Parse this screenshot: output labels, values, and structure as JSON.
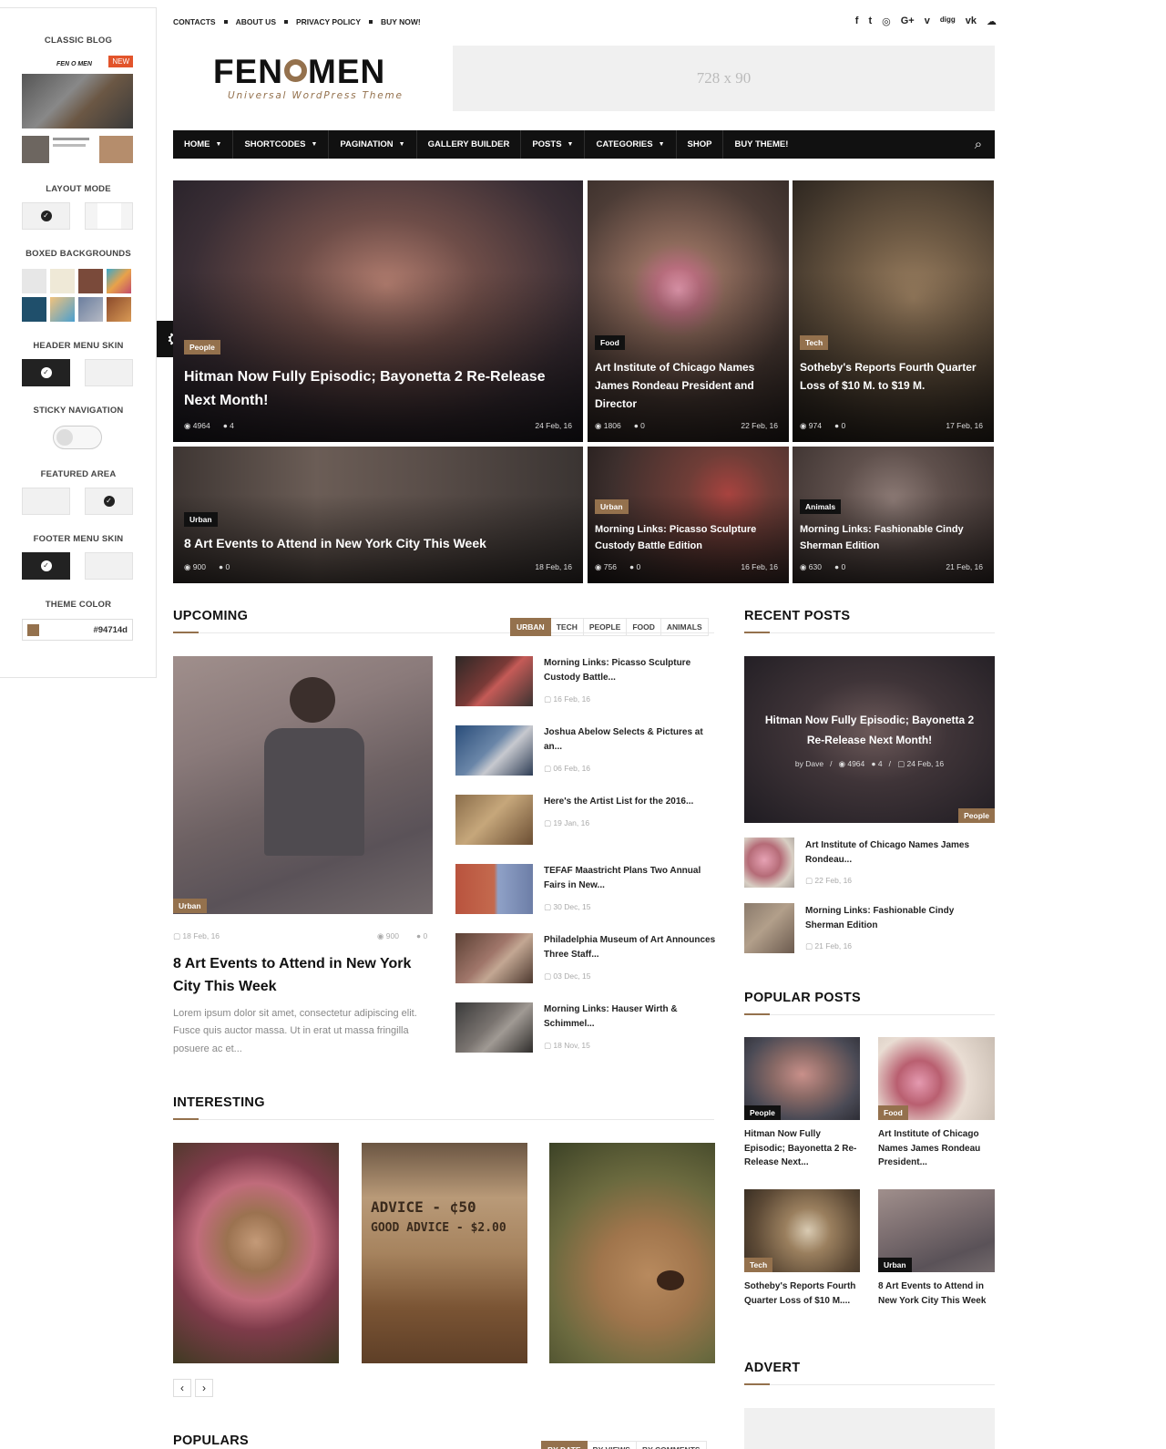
{
  "customizer": {
    "classic_blog": "CLASSIC BLOG",
    "preview_logo": "FEN O MEN",
    "new_badge": "NEW",
    "layout_mode": "LAYOUT MODE",
    "boxed_backgrounds": "BOXED BACKGROUNDS",
    "header_menu_skin": "HEADER MENU SKIN",
    "sticky_navigation": "STICKY NAVIGATION",
    "sticky_enabled": false,
    "featured_area": "FEATURED AREA",
    "footer_menu_skin": "FOOTER MENU SKIN",
    "theme_color_label": "THEME COLOR",
    "theme_color": "#94714d",
    "check_glyph": "✓",
    "gear_glyph": "⚙"
  },
  "topbar": {
    "links": [
      "CONTACTS",
      "ABOUT US",
      "PRIVACY POLICY",
      "BUY NOW!"
    ],
    "socials": [
      "f",
      "t",
      "◎",
      "G+",
      "v",
      "digg",
      "vk",
      "☁"
    ]
  },
  "header": {
    "logo_left": "FEN",
    "logo_right": "MEN",
    "tagline": "Universal WordPress Theme",
    "ad_size": "728 x 90"
  },
  "nav": {
    "items": [
      {
        "label": "HOME",
        "caret": "▼"
      },
      {
        "label": "SHORTCODES",
        "caret": "▼"
      },
      {
        "label": "PAGINATION",
        "caret": "▼"
      },
      {
        "label": "GALLERY BUILDER",
        "caret": ""
      },
      {
        "label": "POSTS",
        "caret": "▼"
      },
      {
        "label": "CATEGORIES",
        "caret": "▼"
      },
      {
        "label": "SHOP",
        "caret": ""
      },
      {
        "label": "BUY THEME!",
        "caret": ""
      }
    ],
    "search_icon": "⌕"
  },
  "featured": [
    {
      "cat": "People",
      "title": "Hitman Now Fully Episodic; Bayonetta 2 Re-Release Next Month!",
      "views": "◉ 4964",
      "comments": "● 4",
      "date": "24 Feb, 16"
    },
    {
      "cat": "Food",
      "title": "Art Institute of Chicago Names James Rondeau President and Director",
      "views": "◉ 1806",
      "comments": "● 0",
      "date": "22 Feb, 16"
    },
    {
      "cat": "Tech",
      "title": "Sotheby's Reports Fourth Quarter Loss of $10 M. to $19 M.",
      "views": "◉ 974",
      "comments": "● 0",
      "date": "17 Feb, 16"
    },
    {
      "cat": "Urban",
      "title": "8 Art Events to Attend in New York City This Week",
      "views": "◉ 900",
      "comments": "● 0",
      "date": "18 Feb, 16"
    },
    {
      "cat": "Urban",
      "title": "Morning Links: Picasso Sculpture Custody Battle Edition",
      "views": "◉ 756",
      "comments": "● 0",
      "date": "16 Feb, 16"
    },
    {
      "cat": "Animals",
      "title": "Morning Links: Fashionable Cindy Sherman Edition",
      "views": "◉ 630",
      "comments": "● 0",
      "date": "21 Feb, 16"
    }
  ],
  "upcoming": {
    "title": "UPCOMING",
    "tabs": [
      "URBAN",
      "TECH",
      "PEOPLE",
      "FOOD",
      "ANIMALS"
    ],
    "main": {
      "badge": "Urban",
      "date": "▢ 18 Feb, 16",
      "views": "◉ 900",
      "comments": "● 0",
      "title": "8 Art Events to Attend in New York City This Week",
      "excerpt": "Lorem ipsum dolor sit amet, consectetur adipiscing elit. Fusce quis auctor massa. Ut in erat ut massa fringilla posuere ac et..."
    },
    "list": [
      {
        "title": "Morning Links: Picasso Sculpture Custody Battle...",
        "date": "▢ 16 Feb, 16"
      },
      {
        "title": "Joshua Abelow Selects & Pictures at an...",
        "date": "▢ 06 Feb, 16"
      },
      {
        "title": "Here's the Artist List for the 2016...",
        "date": "▢ 19 Jan, 16"
      },
      {
        "title": "TEFAF Maastricht Plans Two Annual Fairs in New...",
        "date": "▢ 30 Dec, 15"
      },
      {
        "title": "Philadelphia Museum of Art Announces Three Staff...",
        "date": "▢ 03 Dec, 15"
      },
      {
        "title": "Morning Links: Hauser Wirth & Schimmel...",
        "date": "▢ 18 Nov, 15"
      }
    ]
  },
  "interesting": {
    "title": "INTERESTING",
    "sign_text_1": "ADVICE - ¢50",
    "sign_text_2": "GOOD ADVICE - $2.00",
    "prev": "‹",
    "next": "›"
  },
  "populars": {
    "title": "POPULARS",
    "tabs": [
      "BY DATE",
      "BY VIEWS",
      "BY COMMENTS"
    ]
  },
  "recent": {
    "title": "RECENT POSTS",
    "featured": {
      "title": "Hitman Now Fully Episodic; Bayonetta 2 Re-Release Next Month!",
      "meta": "by Dave   /   ◉ 4964   ● 4   /   ▢ 24 Feb, 16",
      "badge": "People"
    },
    "list": [
      {
        "title": "Art Institute of Chicago Names James Rondeau...",
        "date": "▢ 22 Feb, 16"
      },
      {
        "title": "Morning Links: Fashionable Cindy Sherman Edition",
        "date": "▢ 21 Feb, 16"
      }
    ]
  },
  "popular": {
    "title": "POPULAR POSTS",
    "items": [
      {
        "badge": "People",
        "title": "Hitman Now Fully Episodic; Bayonetta 2 Re-Release Next..."
      },
      {
        "badge": "Food",
        "title": "Art Institute of Chicago Names James Rondeau President..."
      },
      {
        "badge": "Tech",
        "title": "Sotheby's Reports Fourth Quarter Loss of $10 M...."
      },
      {
        "badge": "Urban",
        "title": "8 Art Events to Attend in New York City This Week"
      }
    ]
  },
  "advert": {
    "title": "ADVERT"
  }
}
